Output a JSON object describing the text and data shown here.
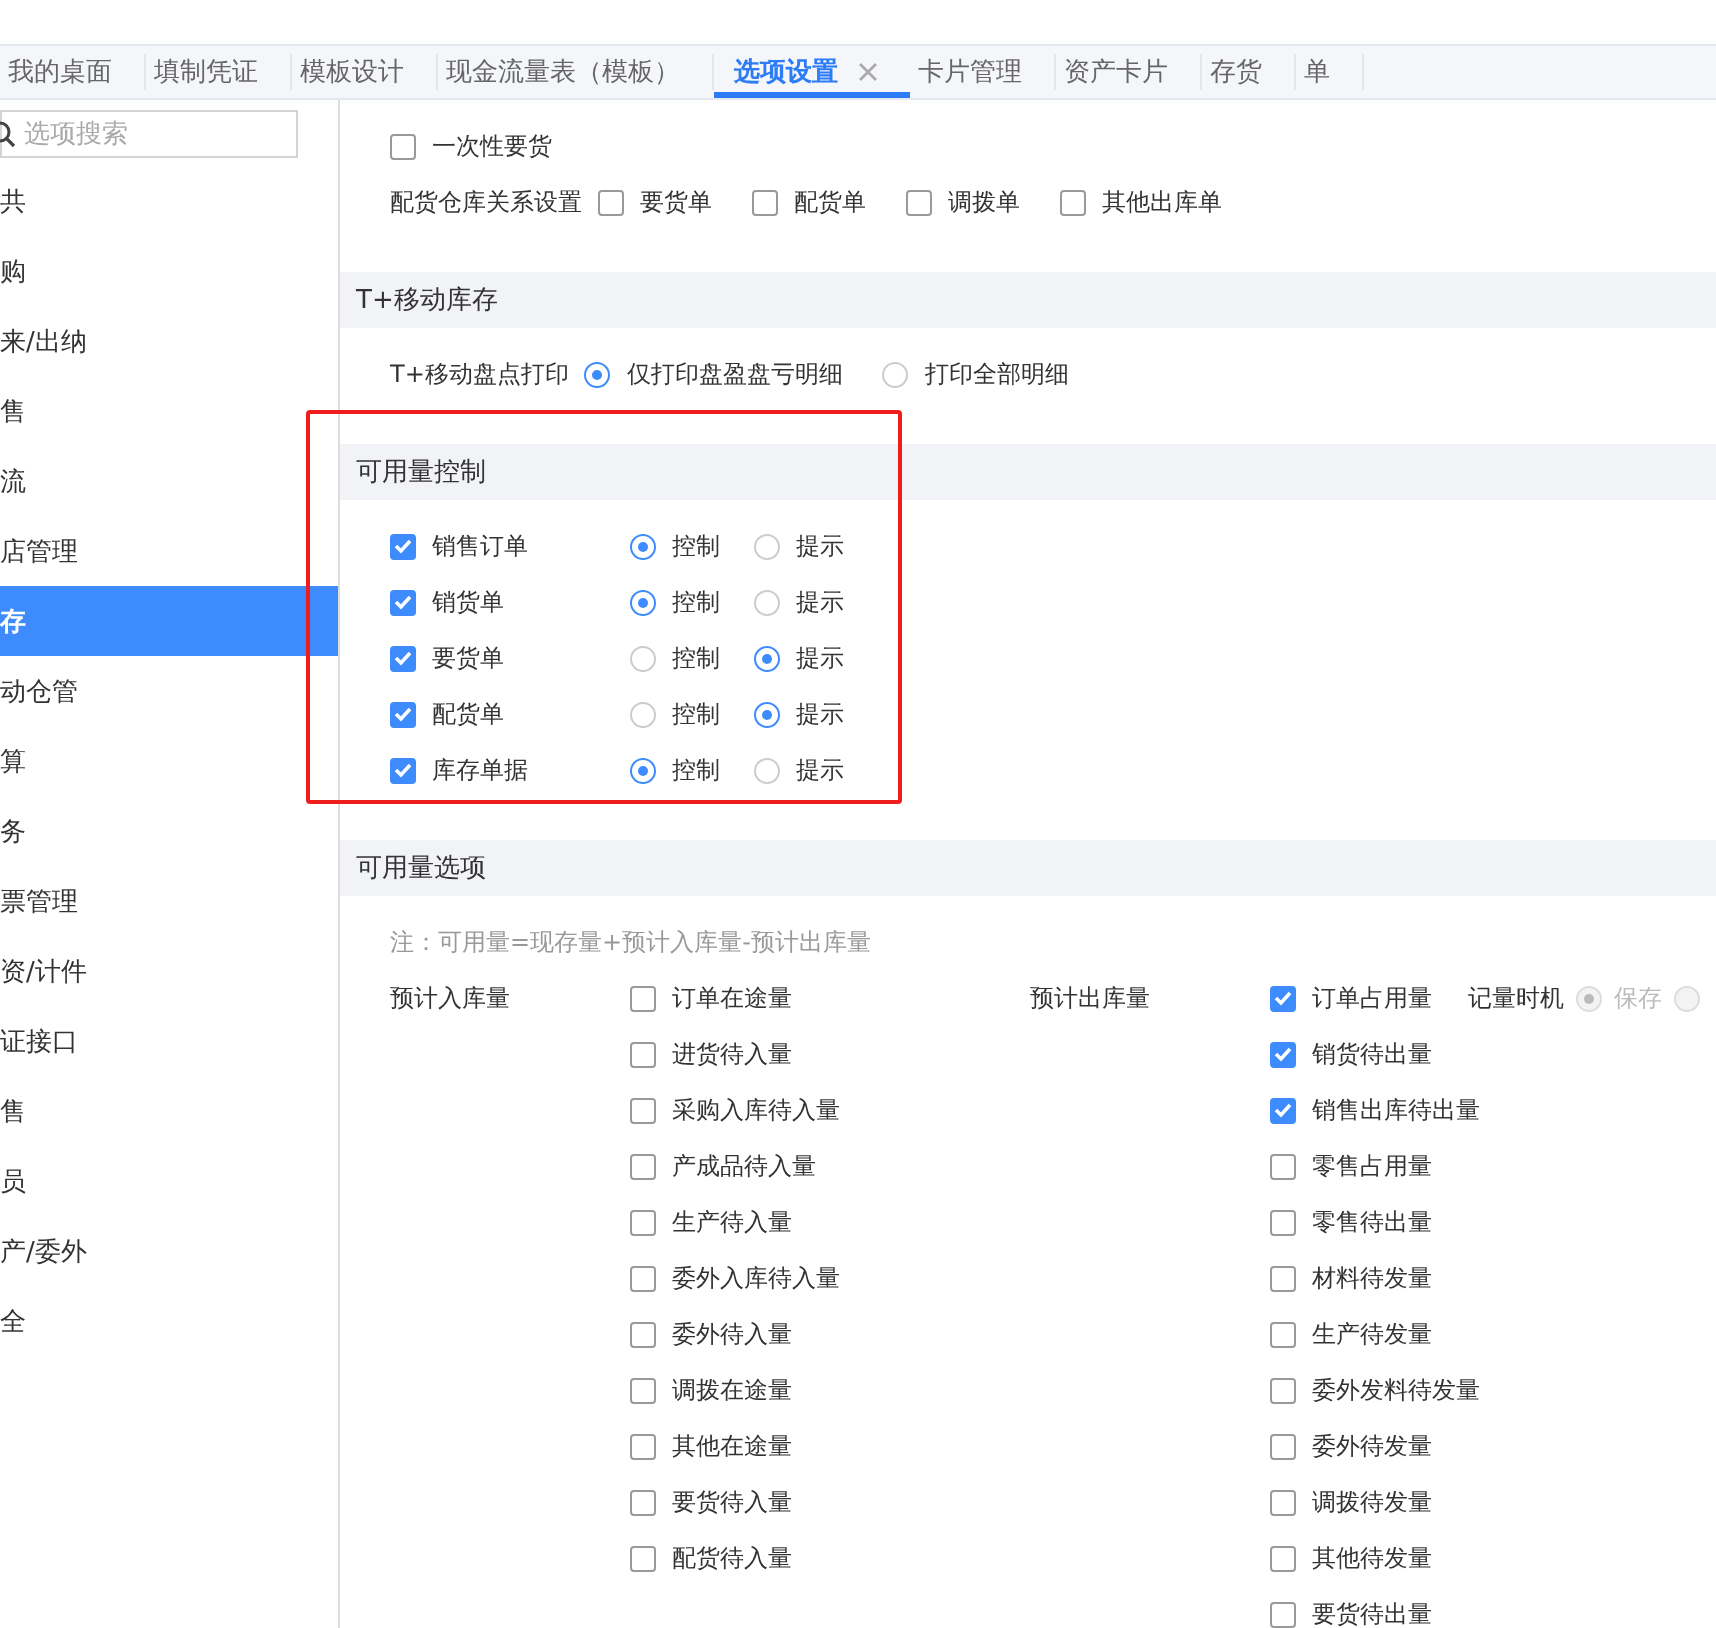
{
  "tabs": [
    {
      "label": "我的桌面",
      "selected": false,
      "closable": false
    },
    {
      "label": "填制凭证",
      "selected": false,
      "closable": false
    },
    {
      "label": "模板设计",
      "selected": false,
      "closable": false
    },
    {
      "label": "现金流量表（模板）",
      "selected": false,
      "closable": false
    },
    {
      "label": "选项设置",
      "selected": true,
      "closable": true
    },
    {
      "label": "卡片管理",
      "selected": false,
      "closable": false
    },
    {
      "label": "资产卡片",
      "selected": false,
      "closable": false
    },
    {
      "label": "存货",
      "selected": false,
      "closable": false
    },
    {
      "label": "单",
      "selected": false,
      "closable": false
    }
  ],
  "search": {
    "placeholder": "选项搜索"
  },
  "sidebar": {
    "items": [
      {
        "label": "共",
        "selected": false
      },
      {
        "label": "购",
        "selected": false
      },
      {
        "label": "来/出纳",
        "selected": false
      },
      {
        "label": "售",
        "selected": false
      },
      {
        "label": "流",
        "selected": false
      },
      {
        "label": "店管理",
        "selected": false
      },
      {
        "label": "存",
        "selected": true
      },
      {
        "label": "动仓管",
        "selected": false
      },
      {
        "label": "算",
        "selected": false
      },
      {
        "label": "务",
        "selected": false
      },
      {
        "label": "票管理",
        "selected": false
      },
      {
        "label": "资/计件",
        "selected": false
      },
      {
        "label": "证接口",
        "selected": false
      },
      {
        "label": "售",
        "selected": false
      },
      {
        "label": "员",
        "selected": false
      },
      {
        "label": "产/委外",
        "selected": false
      },
      {
        "label": "全",
        "selected": false
      }
    ]
  },
  "one_time_requisition": {
    "label": "一次性要货",
    "checked": false
  },
  "warehouse_relation": {
    "label": "配货仓库关系设置",
    "options": [
      {
        "label": "要货单",
        "checked": false
      },
      {
        "label": "配货单",
        "checked": false
      },
      {
        "label": "调拨单",
        "checked": false
      },
      {
        "label": "其他出库单",
        "checked": false
      }
    ]
  },
  "mobile_stock": {
    "title": "T+移动库存",
    "print_label": "T+移动盘点打印",
    "options": [
      {
        "label": "仅打印盘盈盘亏明细",
        "selected": true
      },
      {
        "label": "打印全部明细",
        "selected": false
      }
    ]
  },
  "availability_control": {
    "title": "可用量控制",
    "highlighted": true,
    "rows": [
      {
        "label": "销售订单",
        "checked": true,
        "options": [
          {
            "label": "控制",
            "selected": true
          },
          {
            "label": "提示",
            "selected": false
          }
        ]
      },
      {
        "label": "销货单",
        "checked": true,
        "options": [
          {
            "label": "控制",
            "selected": true
          },
          {
            "label": "提示",
            "selected": false
          }
        ]
      },
      {
        "label": "要货单",
        "checked": true,
        "options": [
          {
            "label": "控制",
            "selected": false
          },
          {
            "label": "提示",
            "selected": true
          }
        ]
      },
      {
        "label": "配货单",
        "checked": true,
        "options": [
          {
            "label": "控制",
            "selected": false
          },
          {
            "label": "提示",
            "selected": true
          }
        ]
      },
      {
        "label": "库存单据",
        "checked": true,
        "options": [
          {
            "label": "控制",
            "selected": true
          },
          {
            "label": "提示",
            "selected": false
          }
        ]
      }
    ]
  },
  "availability_options": {
    "title": "可用量选项",
    "note": "注：可用量=现存量+预计入库量-预计出库量",
    "inbound": {
      "label": "预计入库量",
      "items": [
        {
          "label": "订单在途量",
          "checked": false
        },
        {
          "label": "进货待入量",
          "checked": false
        },
        {
          "label": "采购入库待入量",
          "checked": false
        },
        {
          "label": "产成品待入量",
          "checked": false
        },
        {
          "label": "生产待入量",
          "checked": false
        },
        {
          "label": "委外入库待入量",
          "checked": false
        },
        {
          "label": "委外待入量",
          "checked": false
        },
        {
          "label": "调拨在途量",
          "checked": false
        },
        {
          "label": "其他在途量",
          "checked": false
        },
        {
          "label": "要货待入量",
          "checked": false
        },
        {
          "label": "配货待入量",
          "checked": false
        }
      ]
    },
    "outbound": {
      "label": "预计出库量",
      "items": [
        {
          "label": "订单占用量",
          "checked": true
        },
        {
          "label": "销货待出量",
          "checked": true
        },
        {
          "label": "销售出库待出量",
          "checked": true
        },
        {
          "label": "零售占用量",
          "checked": false
        },
        {
          "label": "零售待出量",
          "checked": false
        },
        {
          "label": "材料待发量",
          "checked": false
        },
        {
          "label": "生产待发量",
          "checked": false
        },
        {
          "label": "委外发料待发量",
          "checked": false
        },
        {
          "label": "委外待发量",
          "checked": false
        },
        {
          "label": "调拨待发量",
          "checked": false
        },
        {
          "label": "其他待发量",
          "checked": false
        },
        {
          "label": "要货待出量",
          "checked": false
        }
      ]
    },
    "timing": {
      "label": "记量时机",
      "disabled": true,
      "options": [
        {
          "label": "保存",
          "selected": true
        },
        {
          "selected": false
        }
      ]
    }
  }
}
